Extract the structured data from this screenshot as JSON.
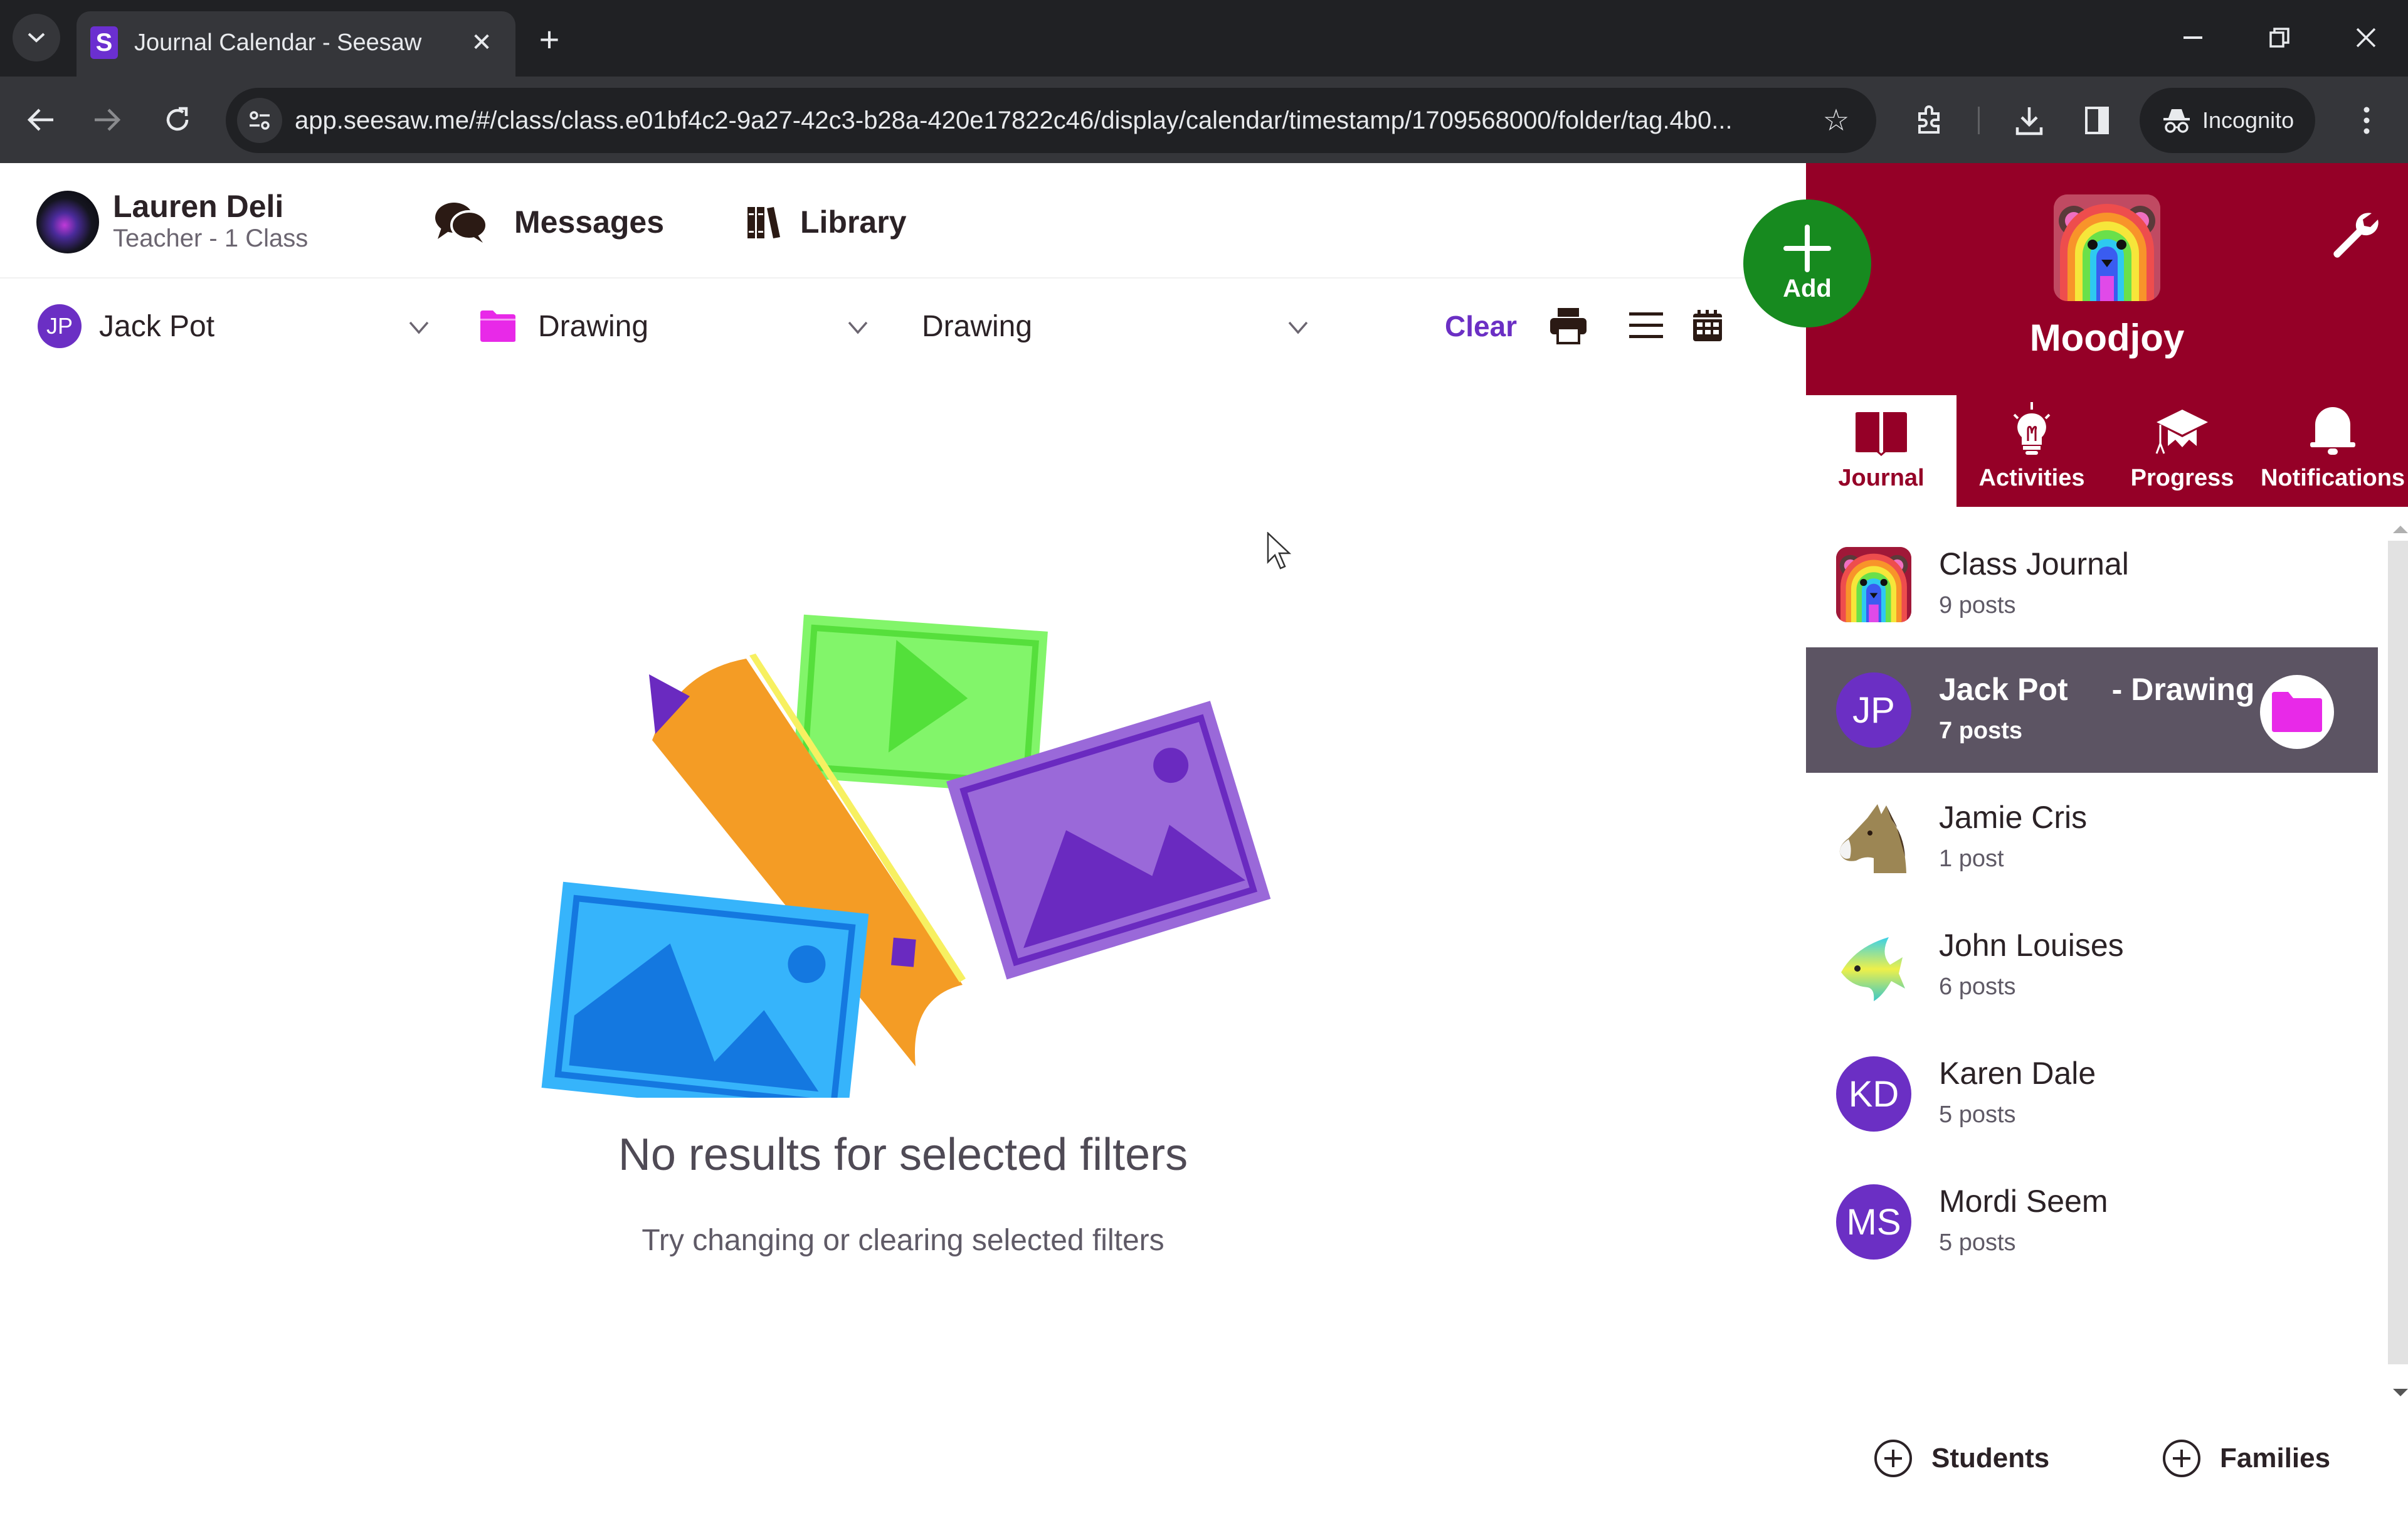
{
  "browser": {
    "tab_title": "Journal Calendar - Seesaw",
    "favicon_letter": "S",
    "url": "app.seesaw.me/#/class/class.e01bf4c2-9a27-42c3-b28a-420e17822c46/display/calendar/timestamp/1709568000/folder/tag.4b0...",
    "incognito_label": "Incognito",
    "new_tab_symbol": "+",
    "close_symbol": "✕"
  },
  "header": {
    "user_name": "Lauren Deli",
    "user_role": "Teacher - 1 Class",
    "messages_label": "Messages",
    "library_label": "Library"
  },
  "filters": {
    "student": {
      "initials": "JP",
      "label": "Jack Pot"
    },
    "folder": {
      "label": "Drawing",
      "color": "#e829e8"
    },
    "tag": {
      "label": "Drawing"
    },
    "clear_label": "Clear"
  },
  "empty_state": {
    "title": "No results for selected filters",
    "subtitle": "Try changing or clearing selected filters"
  },
  "panel": {
    "class_name": "Moodjoy",
    "add_label": "Add",
    "tabs": [
      {
        "label": "Journal",
        "icon": "book-icon",
        "active": true
      },
      {
        "label": "Activities",
        "icon": "lightbulb-icon",
        "active": false
      },
      {
        "label": "Progress",
        "icon": "graduation-cap-icon",
        "active": false
      },
      {
        "label": "Notifications",
        "icon": "bell-icon",
        "active": false
      }
    ],
    "list": [
      {
        "name": "Class Journal",
        "count": "9 posts",
        "avatar": "class-bear"
      },
      {
        "name": "Jack Pot",
        "suffix": "- Drawing",
        "count": "7 posts",
        "avatar": "initials",
        "initials": "JP",
        "selected": true
      },
      {
        "name": "Jamie Cris",
        "count": "1 post",
        "avatar": "horse-emoji"
      },
      {
        "name": "John Louises",
        "count": "6 posts",
        "avatar": "fish-emoji"
      },
      {
        "name": "Karen Dale",
        "count": "5 posts",
        "avatar": "initials",
        "initials": "KD"
      },
      {
        "name": "Mordi Seem",
        "count": "5 posts",
        "avatar": "initials",
        "initials": "MS"
      }
    ],
    "bottom": {
      "students_label": "Students",
      "families_label": "Families"
    }
  },
  "colors": {
    "brand_maroon": "#950027",
    "add_green": "#178a1f",
    "accent_purple": "#6b2fc4",
    "selected_row": "#5c5463"
  }
}
